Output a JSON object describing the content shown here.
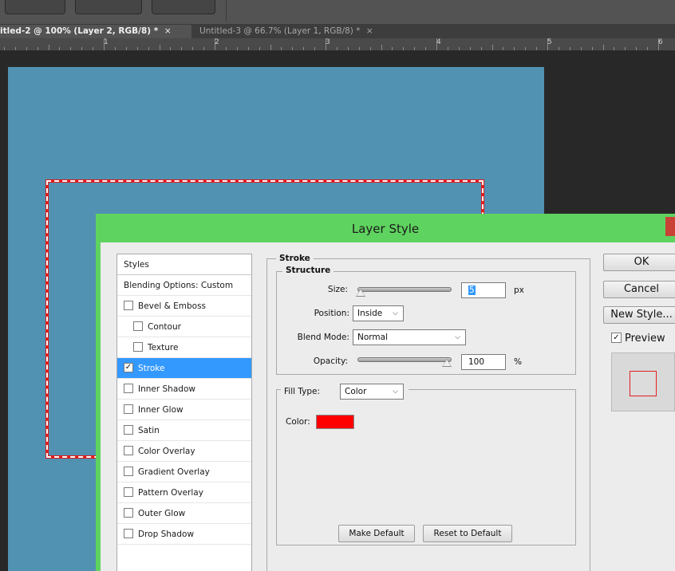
{
  "document_tabs": [
    {
      "label": "itled-2 @ 100% (Layer 2, RGB/8) *",
      "close": "×",
      "active": true
    },
    {
      "label": "Untitled-3 @ 66.7% (Layer 1, RGB/8) *",
      "close": "×",
      "active": false
    }
  ],
  "ruler": {
    "labels": [
      "1",
      "2",
      "3",
      "4",
      "5",
      "6"
    ]
  },
  "dialog": {
    "title": "Layer Style",
    "styles_header": "Styles",
    "blending_options": "Blending Options: Custom",
    "effects": [
      {
        "label": "Bevel & Emboss",
        "checked": false,
        "indent": false
      },
      {
        "label": "Contour",
        "checked": false,
        "indent": true
      },
      {
        "label": "Texture",
        "checked": false,
        "indent": true
      },
      {
        "label": "Stroke",
        "checked": true,
        "indent": false,
        "selected": true
      },
      {
        "label": "Inner Shadow",
        "checked": false,
        "indent": false
      },
      {
        "label": "Inner Glow",
        "checked": false,
        "indent": false
      },
      {
        "label": "Satin",
        "checked": false,
        "indent": false
      },
      {
        "label": "Color Overlay",
        "checked": false,
        "indent": false
      },
      {
        "label": "Gradient Overlay",
        "checked": false,
        "indent": false
      },
      {
        "label": "Pattern Overlay",
        "checked": false,
        "indent": false
      },
      {
        "label": "Outer Glow",
        "checked": false,
        "indent": false
      },
      {
        "label": "Drop Shadow",
        "checked": false,
        "indent": false
      }
    ],
    "stroke": {
      "section_title": "Stroke",
      "structure_title": "Structure",
      "size_label": "Size:",
      "size_value": "5",
      "size_unit": "px",
      "position_label": "Position:",
      "position_value": "Inside",
      "blend_mode_label": "Blend Mode:",
      "blend_mode_value": "Normal",
      "opacity_label": "Opacity:",
      "opacity_value": "100",
      "opacity_unit": "%",
      "fill_type_label": "Fill Type:",
      "fill_type_value": "Color",
      "color_label": "Color:",
      "color_value": "#ff0000",
      "make_default_label": "Make Default",
      "reset_default_label": "Reset to Default"
    },
    "buttons": {
      "ok": "OK",
      "cancel": "Cancel",
      "new_style": "New Style...",
      "preview_label": "Preview",
      "preview_checked": true
    }
  },
  "colors": {
    "dialog_title_bar": "#5fd35f",
    "canvas_background": "#5191b1",
    "stroke_color": "#ff0000",
    "selection_highlight": "#3399ff"
  }
}
